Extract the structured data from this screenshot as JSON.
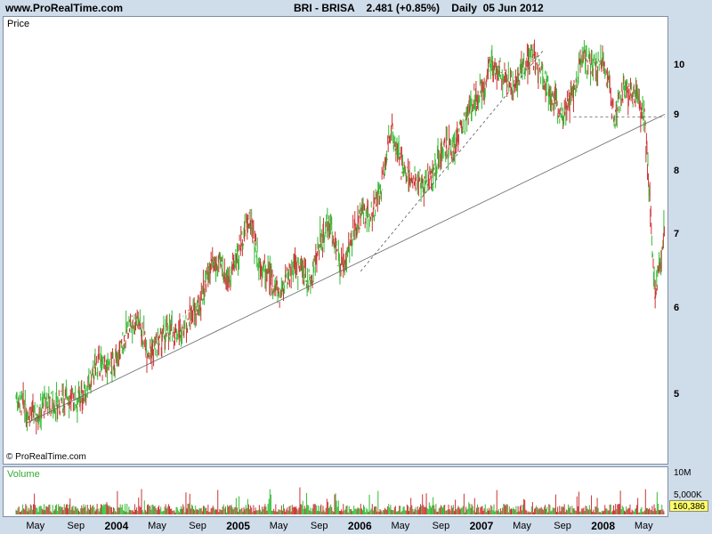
{
  "header": {
    "site": "www.ProRealTime.com",
    "quote": "BRI - BRISA    2.481 (+0.85%)    Daily  05 Jun 2012"
  },
  "price_panel": {
    "label": "Price",
    "copyright": "© ProRealTime.com"
  },
  "volume_panel": {
    "label": "Volume",
    "last_value": "160,386"
  },
  "colors": {
    "up": "#33bb33",
    "down": "#cc3333",
    "background": "#cfdcea"
  },
  "chart_data": {
    "type": "line",
    "style": "ohlc-bars",
    "scale": "log",
    "ylim": [
      4.5,
      10.7
    ],
    "yticks": [
      {
        "value": 10,
        "label": "10"
      },
      {
        "value": 9,
        "label": "9"
      },
      {
        "value": 8,
        "label": "8"
      },
      {
        "value": 7,
        "label": "7"
      },
      {
        "value": 6,
        "label": "6"
      },
      {
        "value": 5,
        "label": "5"
      }
    ],
    "xticks": [
      {
        "date": "2003-05",
        "label": "May",
        "year": false
      },
      {
        "date": "2003-09",
        "label": "Sep",
        "year": false
      },
      {
        "date": "2004-01",
        "label": "2004",
        "year": true
      },
      {
        "date": "2004-05",
        "label": "May",
        "year": false
      },
      {
        "date": "2004-09",
        "label": "Sep",
        "year": false
      },
      {
        "date": "2005-01",
        "label": "2005",
        "year": true
      },
      {
        "date": "2005-05",
        "label": "May",
        "year": false
      },
      {
        "date": "2005-09",
        "label": "Sep",
        "year": false
      },
      {
        "date": "2006-01",
        "label": "2006",
        "year": true
      },
      {
        "date": "2006-05",
        "label": "May",
        "year": false
      },
      {
        "date": "2006-09",
        "label": "Sep",
        "year": false
      },
      {
        "date": "2007-01",
        "label": "2007",
        "year": true
      },
      {
        "date": "2007-05",
        "label": "May",
        "year": false
      },
      {
        "date": "2007-09",
        "label": "Sep",
        "year": false
      },
      {
        "date": "2008-01",
        "label": "2008",
        "year": true
      },
      {
        "date": "2008-05",
        "label": "May",
        "year": false
      }
    ],
    "series": [
      {
        "values": [
          {
            "x": "2003-03",
            "y": 5.0
          },
          {
            "x": "2003-04",
            "y": 4.85
          },
          {
            "x": "2003-05",
            "y": 4.8
          },
          {
            "x": "2003-06",
            "y": 4.95
          },
          {
            "x": "2003-07",
            "y": 4.9
          },
          {
            "x": "2003-08",
            "y": 5.0
          },
          {
            "x": "2003-09",
            "y": 4.95
          },
          {
            "x": "2003-10",
            "y": 5.05
          },
          {
            "x": "2003-11",
            "y": 5.35
          },
          {
            "x": "2003-12",
            "y": 5.3
          },
          {
            "x": "2004-01",
            "y": 5.4
          },
          {
            "x": "2004-02",
            "y": 5.75
          },
          {
            "x": "2004-03",
            "y": 5.9
          },
          {
            "x": "2004-04",
            "y": 5.5
          },
          {
            "x": "2004-05",
            "y": 5.55
          },
          {
            "x": "2004-06",
            "y": 5.75
          },
          {
            "x": "2004-07",
            "y": 5.7
          },
          {
            "x": "2004-08",
            "y": 5.9
          },
          {
            "x": "2004-09",
            "y": 6.0
          },
          {
            "x": "2004-10",
            "y": 6.5
          },
          {
            "x": "2004-11",
            "y": 6.6
          },
          {
            "x": "2004-12",
            "y": 6.4
          },
          {
            "x": "2005-01",
            "y": 6.8
          },
          {
            "x": "2005-02",
            "y": 7.3
          },
          {
            "x": "2005-03",
            "y": 6.6
          },
          {
            "x": "2005-04",
            "y": 6.45
          },
          {
            "x": "2005-05",
            "y": 6.2
          },
          {
            "x": "2005-06",
            "y": 6.5
          },
          {
            "x": "2005-07",
            "y": 6.55
          },
          {
            "x": "2005-08",
            "y": 6.35
          },
          {
            "x": "2005-09",
            "y": 6.9
          },
          {
            "x": "2005-10",
            "y": 7.2
          },
          {
            "x": "2005-11",
            "y": 6.5
          },
          {
            "x": "2005-12",
            "y": 6.9
          },
          {
            "x": "2006-01",
            "y": 7.3
          },
          {
            "x": "2006-02",
            "y": 7.35
          },
          {
            "x": "2006-03",
            "y": 7.7
          },
          {
            "x": "2006-04",
            "y": 8.8
          },
          {
            "x": "2006-05",
            "y": 8.1
          },
          {
            "x": "2006-06",
            "y": 7.9
          },
          {
            "x": "2006-07",
            "y": 7.85
          },
          {
            "x": "2006-08",
            "y": 7.9
          },
          {
            "x": "2006-09",
            "y": 8.4
          },
          {
            "x": "2006-10",
            "y": 8.4
          },
          {
            "x": "2006-11",
            "y": 8.8
          },
          {
            "x": "2006-12",
            "y": 9.3
          },
          {
            "x": "2007-01",
            "y": 9.5
          },
          {
            "x": "2007-02",
            "y": 10.1
          },
          {
            "x": "2007-03",
            "y": 9.9
          },
          {
            "x": "2007-04",
            "y": 9.6
          },
          {
            "x": "2007-05",
            "y": 10.0
          },
          {
            "x": "2007-06",
            "y": 10.2
          },
          {
            "x": "2007-07",
            "y": 9.8
          },
          {
            "x": "2007-08",
            "y": 9.3
          },
          {
            "x": "2007-09",
            "y": 9.0
          },
          {
            "x": "2007-10",
            "y": 9.6
          },
          {
            "x": "2007-11",
            "y": 10.2
          },
          {
            "x": "2007-12",
            "y": 10.0
          },
          {
            "x": "2008-01",
            "y": 10.1
          },
          {
            "x": "2008-02",
            "y": 9.0
          },
          {
            "x": "2008-03",
            "y": 9.55
          },
          {
            "x": "2008-04",
            "y": 9.35
          },
          {
            "x": "2008-05",
            "y": 9.0
          },
          {
            "x": "2008-06",
            "y": 6.2
          },
          {
            "x": "2008-07",
            "y": 7.1
          }
        ]
      }
    ],
    "trendlines": [
      {
        "style": "solid",
        "from": {
          "x": "2003-04",
          "y": 4.72
        },
        "to": {
          "x": "2008-07",
          "y": 9.05
        }
      },
      {
        "style": "dashed",
        "from": {
          "x": "2006-01",
          "y": 6.5
        },
        "to": {
          "x": "2007-07",
          "y": 10.35
        }
      },
      {
        "style": "dashed",
        "from": {
          "x": "2007-10",
          "y": 9.0
        },
        "to": {
          "x": "2008-07",
          "y": 9.0
        }
      }
    ],
    "volume": {
      "label": "Volume",
      "yticks": [
        {
          "value": 10000000,
          "label": "10M"
        },
        {
          "value": 5000000,
          "label": "5,000K"
        }
      ],
      "last": "160,386"
    }
  }
}
